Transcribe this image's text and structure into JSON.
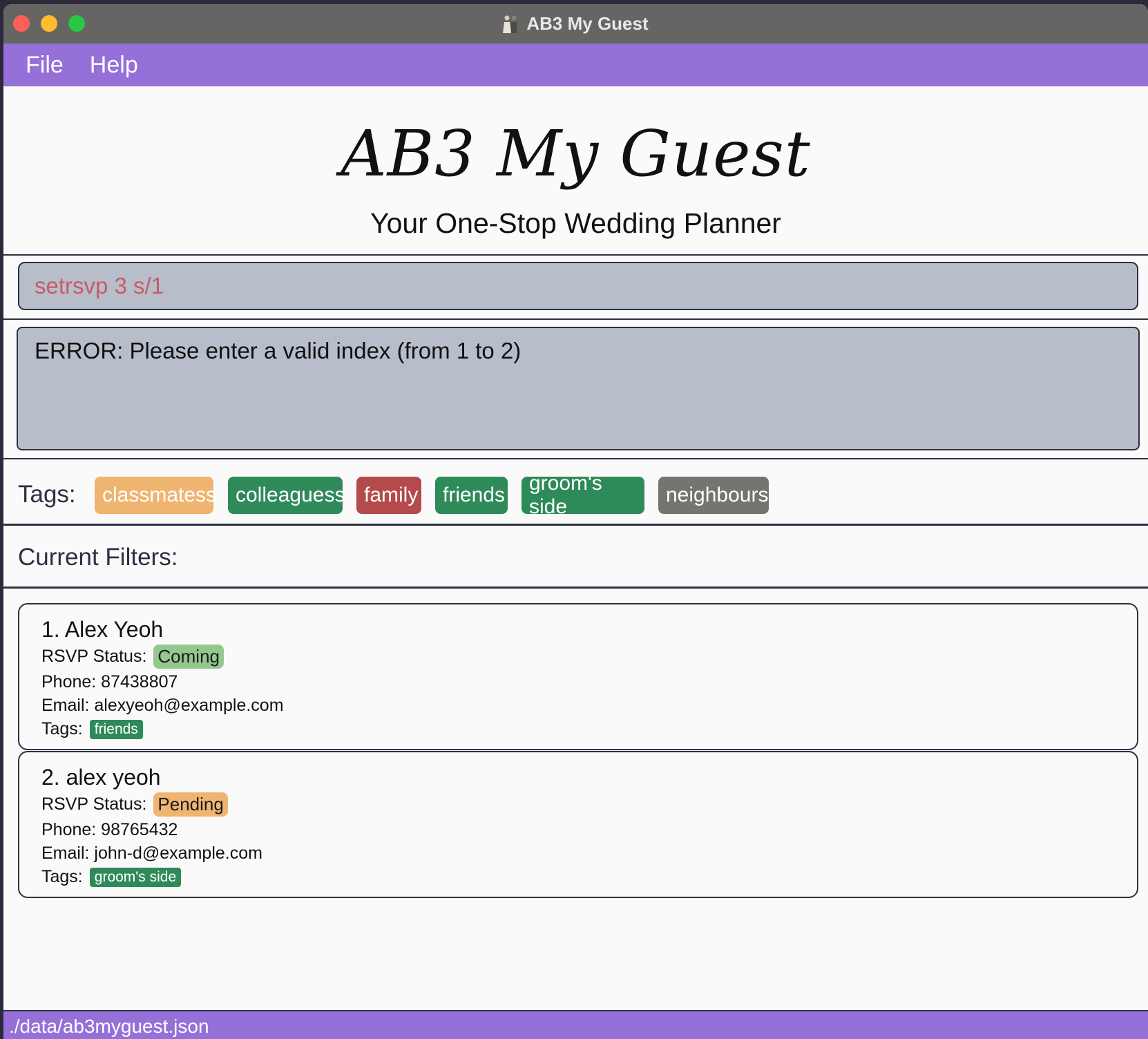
{
  "window": {
    "title": "AB3 My Guest"
  },
  "menu": {
    "file": "File",
    "help": "Help"
  },
  "header": {
    "logo_text": "AB3 My Guest",
    "tagline": "Your One-Stop Wedding Planner"
  },
  "command": {
    "value": "setrsvp 3 s/1"
  },
  "result": {
    "message": "ERROR: Please enter a valid index (from 1 to 2)"
  },
  "tags": {
    "label": "Tags:",
    "items": [
      {
        "label": "classmatess",
        "color": "#efb470"
      },
      {
        "label": "colleaguess",
        "color": "#2f8a5a"
      },
      {
        "label": "family",
        "color": "#b44a4b"
      },
      {
        "label": "friends",
        "color": "#2f8a5a"
      },
      {
        "label": "groom's side",
        "color": "#2f8a5a"
      },
      {
        "label": "neighbours",
        "color": "#76746f"
      }
    ]
  },
  "filters": {
    "label": "Current Filters:"
  },
  "guests": [
    {
      "name": "1. Alex Yeoh",
      "rsvp_label": "RSVP Status:",
      "rsvp": "Coming",
      "rsvp_color": "#94c78e",
      "phone": "Phone: 87438807",
      "email": "Email: alexyeoh@example.com",
      "tags_label": "Tags:",
      "tag": "friends"
    },
    {
      "name": "2. alex yeoh",
      "rsvp_label": "RSVP Status:",
      "rsvp": "Pending",
      "rsvp_color": "#efb470",
      "phone": "Phone: 98765432",
      "email": "Email: john-d@example.com",
      "tags_label": "Tags:",
      "tag": "groom's side"
    }
  ],
  "status": {
    "path": "./data/ab3myguest.json"
  }
}
